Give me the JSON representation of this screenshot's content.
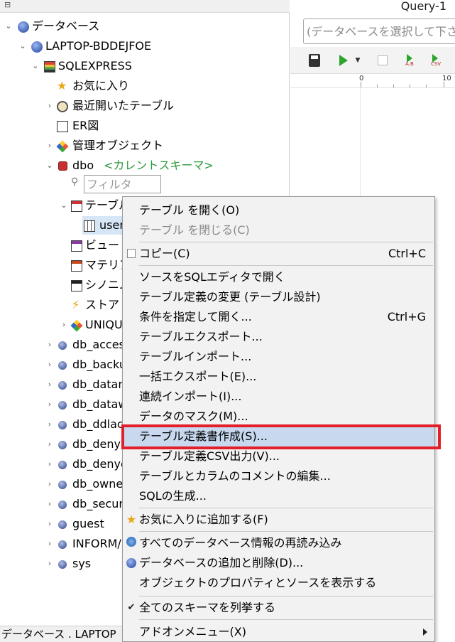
{
  "left_toolbar": {
    "toggle_icon": "tree-icon"
  },
  "tree": {
    "root": "データベース",
    "server": "LAPTOP-BDDEJFOE",
    "instance": "SQLEXPRESS",
    "favorites": "お気に入り",
    "recent_tables": "最近開いたテーブル",
    "er_diagram": "ER図",
    "management_objects": "管理オブジェクト",
    "schema_name": "dbo",
    "schema_note": "<カレントスキーマ>",
    "filter_placeholder": "フィルタ",
    "tables_label": "テーブル",
    "user_table": "user",
    "views": "ビュー",
    "materialized_views": "マテリア",
    "synonyms": "シノニム",
    "stored_procs": "ストアド",
    "unique": "UNIQU",
    "other_schemas": [
      "db_acces",
      "db_backu",
      "db_datar",
      "db_dataw",
      "db_ddlac",
      "db_deny",
      "db_denyc",
      "db_owne",
      "db_secur",
      "guest",
      "INFORM/",
      "sys"
    ]
  },
  "status_bar": {
    "text": "データベース . LAPTOP"
  },
  "editor": {
    "tab_title": "Query-1",
    "db_select_placeholder": "(データベースを選択して下さい)",
    "ruler_labels": [
      "0",
      "10"
    ],
    "toolbar_captions": {
      "export_a": "A.B",
      "export_csv": "CSV"
    }
  },
  "context_menu": {
    "open_table": "テーブル を開く(O)",
    "close_table": "テーブル を閉じる(C)",
    "copy": "コピー(C)",
    "copy_shortcut": "Ctrl+C",
    "open_source_sql": "ソースをSQLエディタで開く",
    "alter_table": "テーブル定義の変更 (テーブル設計)",
    "open_with_condition": "条件を指定して開く...",
    "open_with_condition_shortcut": "Ctrl+G",
    "table_export": "テーブルエクスポート...",
    "table_import": "テーブルインポート...",
    "bulk_export": "一括エクスポート(E)...",
    "sequential_import": "連続インポート(I)...",
    "data_mask": "データのマスク(M)...",
    "create_definition_doc": "テーブル定義書作成(S)...",
    "definition_csv": "テーブル定義CSV出力(V)...",
    "edit_comments": "テーブルとカラムのコメントの編集...",
    "generate_sql": "SQLの生成...",
    "add_favorite": "お気に入りに追加する(F)",
    "reload_all": "すべてのデータベース情報の再読み込み",
    "add_remove_db": "データベースの追加と削除(D)...",
    "show_properties": "オブジェクトのプロパティとソースを表示する",
    "list_all_schemas": "全てのスキーマを列挙する",
    "addon_menu": "アドオンメニュー(X)"
  },
  "colors": {
    "highlight_box": "#e3202a",
    "selected_item": "#c7d8ef",
    "schema_note": "#2e9a3c"
  }
}
